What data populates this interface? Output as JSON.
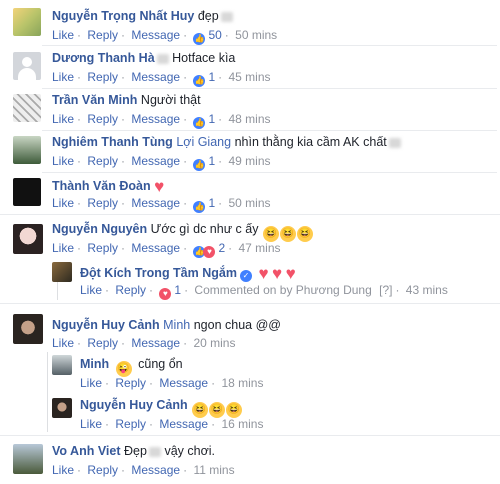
{
  "comments": [
    {
      "name": "Nguyễn Trọng Nhất Huy",
      "text": "đẹp",
      "actions": {
        "like": "Like",
        "reply": "Reply",
        "message": "Message"
      },
      "count": "50",
      "time": "50 mins"
    },
    {
      "name": "Dương Thanh Hà",
      "text": "Hotface kìa",
      "actions": {
        "like": "Like",
        "reply": "Reply",
        "message": "Message"
      },
      "count": "1",
      "time": "45 mins"
    },
    {
      "name": "Trần Văn Minh",
      "text": "Người thật",
      "actions": {
        "like": "Like",
        "reply": "Reply",
        "message": "Message"
      },
      "count": "1",
      "time": "48 mins"
    },
    {
      "name": "Nghiêm Thanh Tùng",
      "tag": "Lợi Giang",
      "text": "nhìn thằng kia cầm AK chất",
      "actions": {
        "like": "Like",
        "reply": "Reply",
        "message": "Message"
      },
      "count": "1",
      "time": "49 mins"
    },
    {
      "name": "Thành Văn Đoàn",
      "actions": {
        "like": "Like",
        "reply": "Reply",
        "message": "Message"
      },
      "count": "1",
      "time": "50 mins"
    },
    {
      "name": "Nguyễn Nguyên",
      "text": "Ước gì dc như c ấy",
      "actions": {
        "like": "Like",
        "reply": "Reply",
        "message": "Message"
      },
      "count": "2",
      "time": "47 mins"
    },
    {
      "name": "Đột Kích Trong Tầm Ngắm",
      "actions": {
        "like": "Like",
        "reply": "Reply"
      },
      "count": "1",
      "commented_by": "Commented on by Phương Dung",
      "flag": "[?]",
      "time": "43 mins"
    },
    {
      "name": "Nguyễn Huy Cảnh",
      "tag": "Minh",
      "text": "ngon chua @@",
      "actions": {
        "like": "Like",
        "reply": "Reply",
        "message": "Message"
      },
      "time": "20 mins"
    },
    {
      "name": "Minh",
      "text": "cũng ổn",
      "actions": {
        "like": "Like",
        "reply": "Reply",
        "message": "Message"
      },
      "time": "18 mins"
    },
    {
      "name": "Nguyễn Huy Cảnh",
      "actions": {
        "like": "Like",
        "reply": "Reply",
        "message": "Message"
      },
      "time": "16 mins"
    },
    {
      "name": "Vo Anh Viet",
      "text": "Đẹp",
      "text2": "vậy chơi.",
      "actions": {
        "like": "Like",
        "reply": "Reply",
        "message": "Message"
      },
      "time": "11 mins"
    }
  ],
  "colors": {
    "name": "#365899",
    "action": "#4267b2",
    "meta": "#90949c",
    "like": "#4080ff",
    "heart": "#f25268"
  }
}
